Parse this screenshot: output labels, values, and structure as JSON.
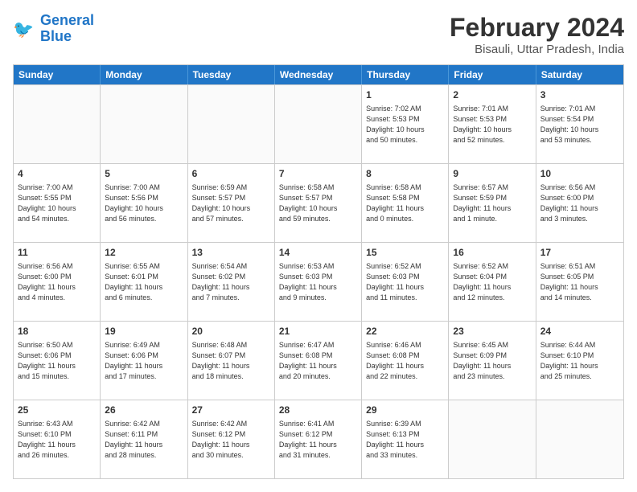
{
  "logo": {
    "line1": "General",
    "line2": "Blue"
  },
  "title": "February 2024",
  "location": "Bisauli, Uttar Pradesh, India",
  "header_days": [
    "Sunday",
    "Monday",
    "Tuesday",
    "Wednesday",
    "Thursday",
    "Friday",
    "Saturday"
  ],
  "rows": [
    [
      {
        "day": "",
        "info": ""
      },
      {
        "day": "",
        "info": ""
      },
      {
        "day": "",
        "info": ""
      },
      {
        "day": "",
        "info": ""
      },
      {
        "day": "1",
        "info": "Sunrise: 7:02 AM\nSunset: 5:53 PM\nDaylight: 10 hours\nand 50 minutes."
      },
      {
        "day": "2",
        "info": "Sunrise: 7:01 AM\nSunset: 5:53 PM\nDaylight: 10 hours\nand 52 minutes."
      },
      {
        "day": "3",
        "info": "Sunrise: 7:01 AM\nSunset: 5:54 PM\nDaylight: 10 hours\nand 53 minutes."
      }
    ],
    [
      {
        "day": "4",
        "info": "Sunrise: 7:00 AM\nSunset: 5:55 PM\nDaylight: 10 hours\nand 54 minutes."
      },
      {
        "day": "5",
        "info": "Sunrise: 7:00 AM\nSunset: 5:56 PM\nDaylight: 10 hours\nand 56 minutes."
      },
      {
        "day": "6",
        "info": "Sunrise: 6:59 AM\nSunset: 5:57 PM\nDaylight: 10 hours\nand 57 minutes."
      },
      {
        "day": "7",
        "info": "Sunrise: 6:58 AM\nSunset: 5:57 PM\nDaylight: 10 hours\nand 59 minutes."
      },
      {
        "day": "8",
        "info": "Sunrise: 6:58 AM\nSunset: 5:58 PM\nDaylight: 11 hours\nand 0 minutes."
      },
      {
        "day": "9",
        "info": "Sunrise: 6:57 AM\nSunset: 5:59 PM\nDaylight: 11 hours\nand 1 minute."
      },
      {
        "day": "10",
        "info": "Sunrise: 6:56 AM\nSunset: 6:00 PM\nDaylight: 11 hours\nand 3 minutes."
      }
    ],
    [
      {
        "day": "11",
        "info": "Sunrise: 6:56 AM\nSunset: 6:00 PM\nDaylight: 11 hours\nand 4 minutes."
      },
      {
        "day": "12",
        "info": "Sunrise: 6:55 AM\nSunset: 6:01 PM\nDaylight: 11 hours\nand 6 minutes."
      },
      {
        "day": "13",
        "info": "Sunrise: 6:54 AM\nSunset: 6:02 PM\nDaylight: 11 hours\nand 7 minutes."
      },
      {
        "day": "14",
        "info": "Sunrise: 6:53 AM\nSunset: 6:03 PM\nDaylight: 11 hours\nand 9 minutes."
      },
      {
        "day": "15",
        "info": "Sunrise: 6:52 AM\nSunset: 6:03 PM\nDaylight: 11 hours\nand 11 minutes."
      },
      {
        "day": "16",
        "info": "Sunrise: 6:52 AM\nSunset: 6:04 PM\nDaylight: 11 hours\nand 12 minutes."
      },
      {
        "day": "17",
        "info": "Sunrise: 6:51 AM\nSunset: 6:05 PM\nDaylight: 11 hours\nand 14 minutes."
      }
    ],
    [
      {
        "day": "18",
        "info": "Sunrise: 6:50 AM\nSunset: 6:06 PM\nDaylight: 11 hours\nand 15 minutes."
      },
      {
        "day": "19",
        "info": "Sunrise: 6:49 AM\nSunset: 6:06 PM\nDaylight: 11 hours\nand 17 minutes."
      },
      {
        "day": "20",
        "info": "Sunrise: 6:48 AM\nSunset: 6:07 PM\nDaylight: 11 hours\nand 18 minutes."
      },
      {
        "day": "21",
        "info": "Sunrise: 6:47 AM\nSunset: 6:08 PM\nDaylight: 11 hours\nand 20 minutes."
      },
      {
        "day": "22",
        "info": "Sunrise: 6:46 AM\nSunset: 6:08 PM\nDaylight: 11 hours\nand 22 minutes."
      },
      {
        "day": "23",
        "info": "Sunrise: 6:45 AM\nSunset: 6:09 PM\nDaylight: 11 hours\nand 23 minutes."
      },
      {
        "day": "24",
        "info": "Sunrise: 6:44 AM\nSunset: 6:10 PM\nDaylight: 11 hours\nand 25 minutes."
      }
    ],
    [
      {
        "day": "25",
        "info": "Sunrise: 6:43 AM\nSunset: 6:10 PM\nDaylight: 11 hours\nand 26 minutes."
      },
      {
        "day": "26",
        "info": "Sunrise: 6:42 AM\nSunset: 6:11 PM\nDaylight: 11 hours\nand 28 minutes."
      },
      {
        "day": "27",
        "info": "Sunrise: 6:42 AM\nSunset: 6:12 PM\nDaylight: 11 hours\nand 30 minutes."
      },
      {
        "day": "28",
        "info": "Sunrise: 6:41 AM\nSunset: 6:12 PM\nDaylight: 11 hours\nand 31 minutes."
      },
      {
        "day": "29",
        "info": "Sunrise: 6:39 AM\nSunset: 6:13 PM\nDaylight: 11 hours\nand 33 minutes."
      },
      {
        "day": "",
        "info": ""
      },
      {
        "day": "",
        "info": ""
      }
    ]
  ]
}
